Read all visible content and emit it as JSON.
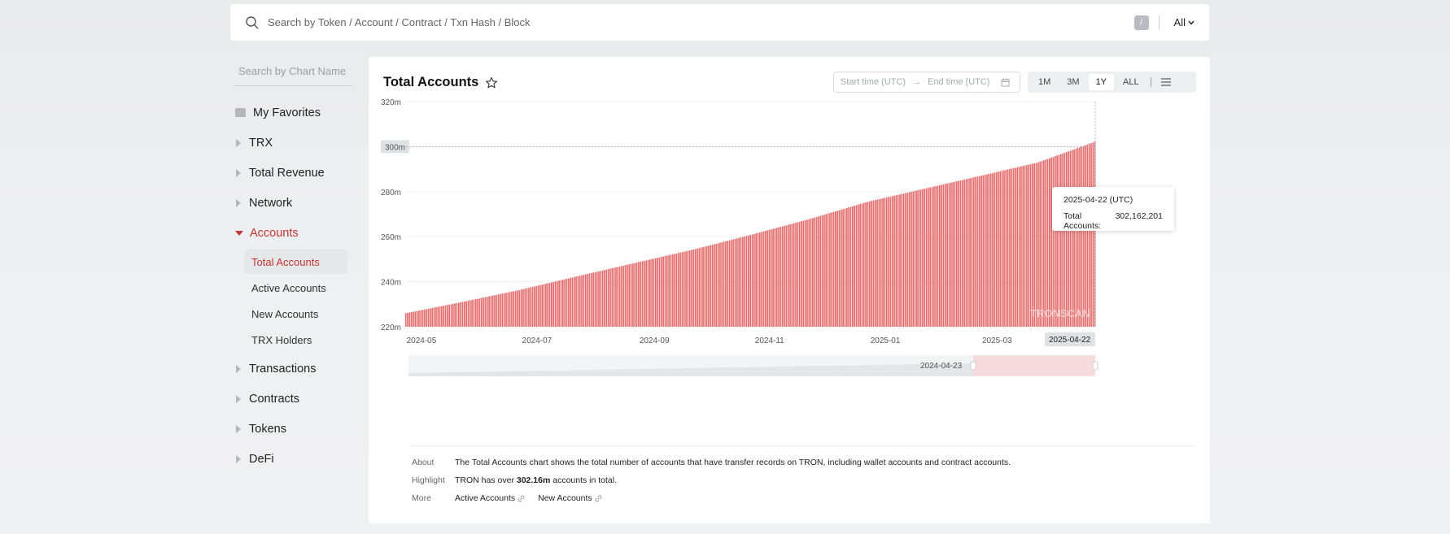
{
  "search": {
    "placeholder": "Search by Token / Account / Contract / Txn Hash / Block",
    "shortcut": "/",
    "scope": "All"
  },
  "sidebar": {
    "chart_search_placeholder": "Search by Chart Name",
    "items": [
      {
        "label": "My Favorites",
        "icon": "folder-icon"
      },
      {
        "label": "TRX"
      },
      {
        "label": "Total Revenue"
      },
      {
        "label": "Network"
      },
      {
        "label": "Accounts",
        "expanded": true,
        "sub": [
          "Total Accounts",
          "Active Accounts",
          "New Accounts",
          "TRX Holders"
        ],
        "selected": "Total Accounts"
      },
      {
        "label": "Transactions"
      },
      {
        "label": "Contracts"
      },
      {
        "label": "Tokens"
      },
      {
        "label": "DeFi"
      }
    ]
  },
  "card": {
    "title": "Total Accounts",
    "start_placeholder": "Start time (UTC)",
    "end_placeholder": "End time (UTC)",
    "ranges": [
      "1M",
      "3M",
      "1Y",
      "ALL"
    ],
    "active_range": "1Y"
  },
  "chart_data": {
    "type": "bar",
    "title": "Total Accounts",
    "xlabel": "",
    "ylabel": "",
    "x_ticks": [
      "2024-05",
      "2024-07",
      "2024-09",
      "2024-11",
      "2025-01",
      "2025-03"
    ],
    "x_start": "2024-04-23",
    "x_end": "2025-04-22",
    "y_ticks": [
      "220m",
      "240m",
      "260m",
      "280m",
      "300m",
      "320m"
    ],
    "ylim": [
      220,
      320
    ],
    "y_unit": "m",
    "series": [
      {
        "points": [
          [
            "2024-04-23",
            226.0
          ],
          [
            "2024-05-23",
            231.0
          ],
          [
            "2024-06-23",
            236.5
          ],
          [
            "2024-07-23",
            242.5
          ],
          [
            "2024-08-23",
            248.5
          ],
          [
            "2024-09-23",
            254.5
          ],
          [
            "2024-10-23",
            261.0
          ],
          [
            "2024-11-23",
            268.0
          ],
          [
            "2024-12-23",
            275.5
          ],
          [
            "2025-01-23",
            281.5
          ],
          [
            "2025-02-23",
            287.5
          ],
          [
            "2025-03-23",
            293.0
          ],
          [
            "2025-04-22",
            302.16
          ]
        ]
      }
    ],
    "color": "#e46b6b",
    "crosshair_y_label": "300m",
    "crosshair_x_label": "2025-04-22",
    "zoom_start_label": "2024-04-23",
    "watermark": "TRONSCAN",
    "tooltip": {
      "date": "2025-04-22 (UTC)",
      "label": "Total Accounts:",
      "value": "302,162,201"
    }
  },
  "info": {
    "about_label": "About",
    "about_text": "The Total Accounts chart shows the total number of accounts that have transfer records on TRON, including wallet accounts and contract accounts.",
    "highlight_label": "Highlight",
    "highlight_pre": "TRON has over ",
    "highlight_value": "302.16m",
    "highlight_post": " accounts in total.",
    "more_label": "More",
    "more_links": [
      "Active Accounts",
      "New Accounts"
    ]
  }
}
